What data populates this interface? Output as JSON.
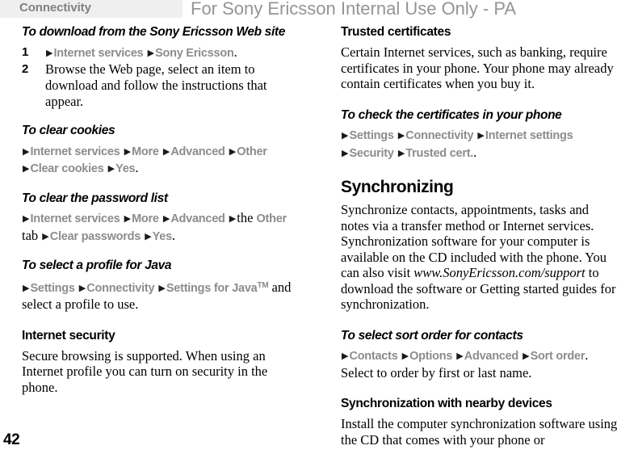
{
  "header": {
    "chapter": "Connectivity",
    "watermark": "For Sony Ericsson Internal Use Only - PA"
  },
  "folio": "42",
  "left_column": {
    "proc_download": {
      "heading": "To download from the Sony Ericsson Web site",
      "steps": [
        {
          "num": "1",
          "path": [
            "Internet services",
            "Sony Ericsson"
          ],
          "trailing": "."
        },
        {
          "num": "2",
          "text": "Browse the Web page, select an item to download and follow the instructions that appear."
        }
      ]
    },
    "proc_clear_cookies": {
      "heading": "To clear cookies",
      "path": [
        "Internet services",
        "More",
        "Advanced",
        "Other",
        "Clear cookies",
        "Yes"
      ],
      "trailing": "."
    },
    "proc_clear_password_list": {
      "heading": "To clear the password list",
      "path_pre": [
        "Internet services",
        "More",
        "Advanced"
      ],
      "interleaved_word_1": "the",
      "path_mid": [
        "Other"
      ],
      "interleaved_word_2": "tab",
      "path_post": [
        "Clear passwords",
        "Yes"
      ],
      "trailing": "."
    },
    "proc_select_profile_java": {
      "heading": "To select a profile for Java",
      "path": [
        "Settings",
        "Connectivity",
        "Settings for Java"
      ],
      "trademark": "TM",
      "tail_text": "and select a profile to use."
    },
    "sec_internet_security": {
      "heading": "Internet security",
      "body": "Secure browsing is supported. When using an Internet profile you can turn on security in the phone."
    }
  },
  "right_column": {
    "sec_trusted_certificates": {
      "heading": "Trusted certificates",
      "body": "Certain Internet services, such as banking, require certificates in your phone. Your phone may already contain certificates when you buy it."
    },
    "proc_check_certificates": {
      "heading": "To check the certificates in your phone",
      "path": [
        "Settings",
        "Connectivity",
        "Internet settings",
        "Security",
        "Trusted cert."
      ],
      "trailing": "."
    },
    "sec_synchronizing": {
      "heading": "Synchronizing",
      "body_part1": "Synchronize contacts, appointments, tasks and notes via a transfer method or Internet services. Synchronization software for your computer is available on the CD included with the phone. You can also visit ",
      "body_url": "www.SonyEricsson.com/support",
      "body_part2": " to download the software or Getting started guides for synchronization."
    },
    "proc_sort_order": {
      "heading": "To select sort order for contacts",
      "path": [
        "Contacts",
        "Options",
        "Advanced",
        "Sort order"
      ],
      "trailing": ".",
      "tail_text": "Select to order by first or last name."
    },
    "sec_nearby_devices": {
      "heading": "Synchronization with nearby devices",
      "body": "Install the computer synchronization software using the CD that comes with your phone or"
    }
  }
}
